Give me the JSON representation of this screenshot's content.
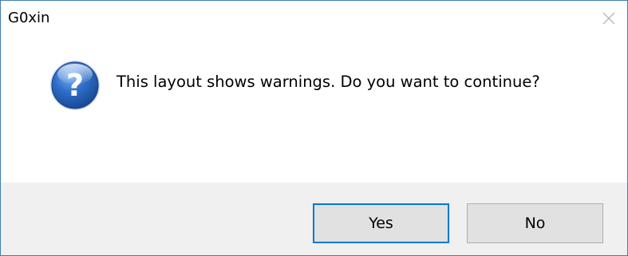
{
  "window": {
    "title": "G0xin",
    "close_icon": "close-icon"
  },
  "message": {
    "icon": "question-icon",
    "text": "This layout shows warnings. Do you want to continue?"
  },
  "buttons": {
    "yes_label": "Yes",
    "no_label": "No",
    "default": "yes"
  },
  "colors": {
    "border": "#3c7fb1",
    "footer_bg": "#f0f0f0",
    "button_bg": "#e1e1e1",
    "button_border": "#adadad",
    "focus_border": "#0078d7",
    "icon_blue": "#1f5fb5"
  }
}
